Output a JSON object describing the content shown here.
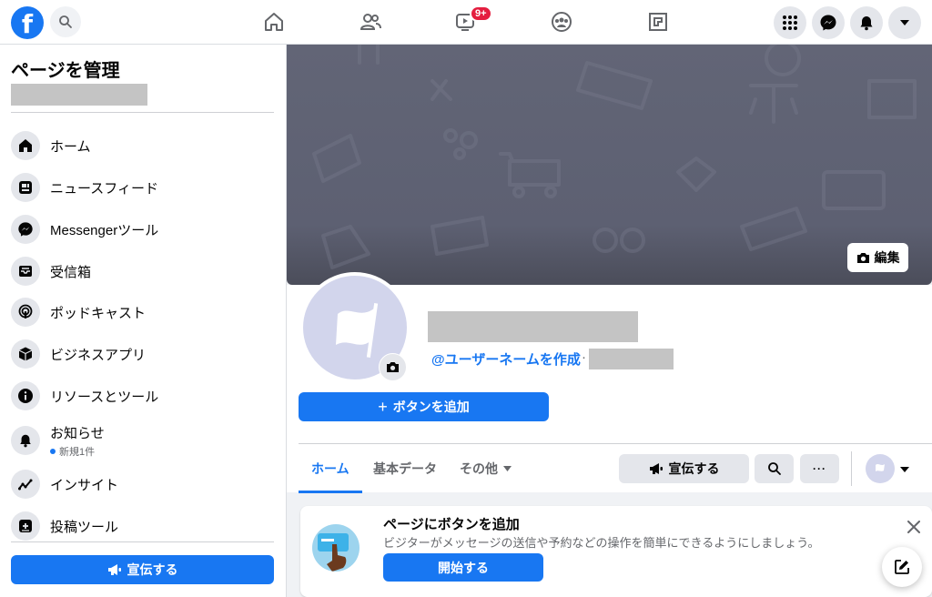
{
  "topbar": {
    "logo": "f",
    "video_badge": "9+",
    "icons": [
      "search-icon",
      "home-icon",
      "friends-icon",
      "watch-icon",
      "groups-icon",
      "gaming-icon",
      "menu-grid-icon",
      "messenger-icon",
      "bell-icon",
      "caret-down-icon"
    ]
  },
  "sidebar": {
    "title": "ページを管理",
    "items": [
      {
        "label": "ホーム",
        "icon": "home-icon"
      },
      {
        "label": "ニュースフィード",
        "icon": "news-feed-icon"
      },
      {
        "label": "Messengerツール",
        "icon": "messenger-icon"
      },
      {
        "label": "受信箱",
        "icon": "inbox-icon"
      },
      {
        "label": "ポッドキャスト",
        "icon": "podcast-icon"
      },
      {
        "label": "ビジネスアプリ",
        "icon": "cube-icon"
      },
      {
        "label": "リソースとツール",
        "icon": "info-icon"
      },
      {
        "label": "お知らせ",
        "icon": "bell-icon",
        "sub": "新規1件"
      },
      {
        "label": "インサイト",
        "icon": "insights-icon"
      },
      {
        "label": "投稿ツール",
        "icon": "publishing-tools-icon"
      }
    ],
    "promote_label": "宣伝する"
  },
  "cover": {
    "edit_label": "編集"
  },
  "profile": {
    "username_link": "@ユーザーネームを作成",
    "separator": "·",
    "add_button_label": "ボタンを追加"
  },
  "tabs": [
    {
      "label": "ホーム",
      "active": true
    },
    {
      "label": "基本データ",
      "active": false
    },
    {
      "label": "その他",
      "active": false
    }
  ],
  "actions": {
    "promote_label": "宣伝する",
    "more_label": "···"
  },
  "card": {
    "title": "ページにボタンを追加",
    "description": "ビジターがメッセージの送信や予約などの操作を簡単にできるようにしましょう。",
    "start_label": "開始する"
  },
  "colors": {
    "accent": "#1877f2",
    "badge": "#e41e3f",
    "cover": "#5d6072"
  }
}
